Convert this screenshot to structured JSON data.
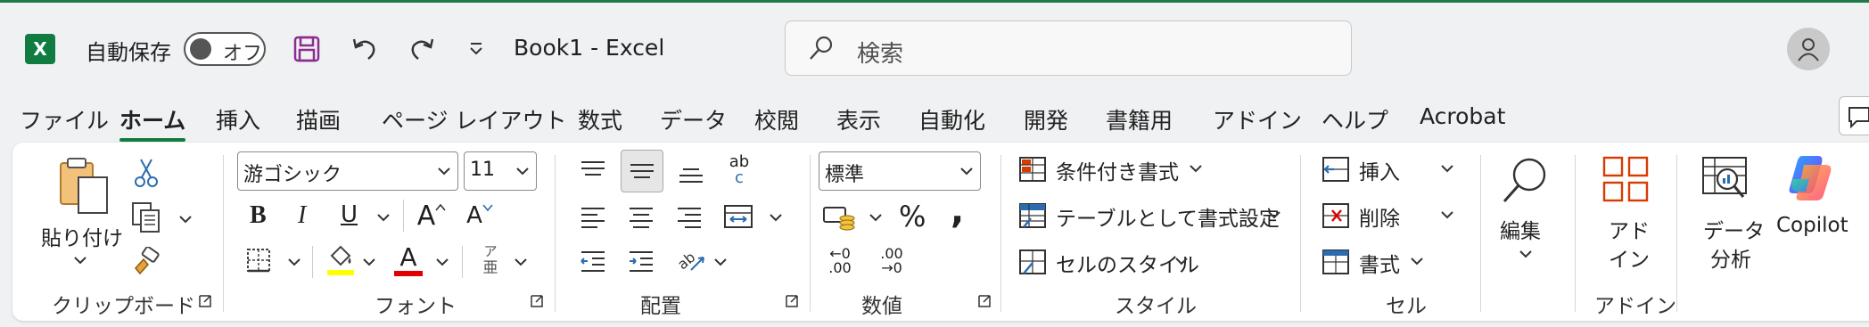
{
  "titlebar": {
    "app_icon_letter": "X",
    "autosave_label": "自動保存",
    "autosave_toggle": "オフ",
    "document_title": "Book1  -  Excel",
    "search_placeholder": "検索"
  },
  "tabs": [
    "ファイル",
    "ホーム",
    "挿入",
    "描画",
    "ページ レイアウト",
    "数式",
    "データ",
    "校閲",
    "表示",
    "自動化",
    "開発",
    "書籍用",
    "アドイン",
    "ヘルプ",
    "Acrobat"
  ],
  "active_tab": "ホーム",
  "clipboard": {
    "paste_label": "貼り付け",
    "group_label": "クリップボード"
  },
  "font": {
    "font_name": "游ゴシック",
    "font_size": "11",
    "bold": "B",
    "italic": "I",
    "underline": "U",
    "grow": "A",
    "shrink": "A",
    "font_color_letter": "A",
    "phonetic_top": "ア",
    "phonetic_bottom": "亜",
    "group_label": "フォント"
  },
  "alignment": {
    "group_label": "配置",
    "wrap_top": "ab",
    "wrap_bottom": "c"
  },
  "number": {
    "format": "標準",
    "percent": "%",
    "comma": ",",
    "inc_decimal": "←0 .00",
    "dec_decimal": ".00 →0",
    "group_label": "数値"
  },
  "styles": {
    "conditional": "条件付き書式",
    "as_table": "テーブルとして書式設定",
    "cell_styles": "セルのスタイル",
    "group_label": "スタイル"
  },
  "cells": {
    "insert": "挿入",
    "delete": "削除",
    "format": "書式",
    "group_label": "セル"
  },
  "editing": {
    "label": "編集"
  },
  "addins": {
    "addin_line1": "アド",
    "addin_line2": "イン",
    "group_label": "アドイン"
  },
  "analysis": {
    "line1": "データ",
    "line2": "分析"
  },
  "copilot": {
    "label": "Copilot"
  },
  "colors": {
    "excel_green": "#107c41",
    "font_highlight": "#ffff00",
    "font_color": "#e00000",
    "addin_red": "#d83b01"
  }
}
